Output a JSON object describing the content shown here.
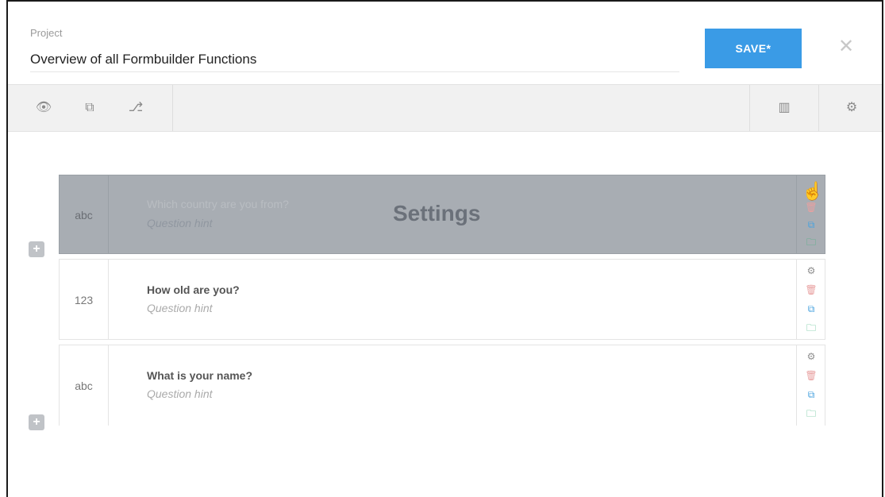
{
  "header": {
    "project_label": "Project",
    "project_title": "Overview of all Formbuilder Functions",
    "save_label": "SAVE*",
    "close_glyph": "✕"
  },
  "toolbar": {
    "left_icons": [
      {
        "name": "preview-eye-icon",
        "glyph": "👁"
      },
      {
        "name": "duplicate-pages-icon",
        "glyph": "⧉"
      },
      {
        "name": "logic-flow-icon",
        "glyph": "⎇"
      }
    ],
    "right_icons": [
      {
        "name": "layout-columns-icon",
        "glyph": "▥"
      },
      {
        "name": "settings-gear-icon",
        "glyph": "⚙"
      }
    ]
  },
  "questions": [
    {
      "type": "abc",
      "question": "Which country are you from?",
      "hint": "Question hint",
      "state": "dragging",
      "overlay": "Settings"
    },
    {
      "type": "123",
      "question": "How old are you?",
      "hint": "Question hint",
      "state": "normal"
    },
    {
      "type": "abc",
      "question": "What is your name?",
      "hint": "Question hint",
      "state": "normal"
    }
  ],
  "row_actions": [
    {
      "name": "settings-icon",
      "glyph": "⚙",
      "color": "#8e8e8e"
    },
    {
      "name": "delete-icon",
      "glyph": "🗑",
      "color": "#e8a0a0"
    },
    {
      "name": "copy-icon",
      "glyph": "⧉",
      "color": "#4aa3df"
    },
    {
      "name": "move-folder-icon",
      "glyph": "🗀",
      "color": "#3ab37a"
    }
  ],
  "add_glyph": "+",
  "colors": {
    "accent": "#3a9be6",
    "drag_overlay": "#a8adb3"
  }
}
